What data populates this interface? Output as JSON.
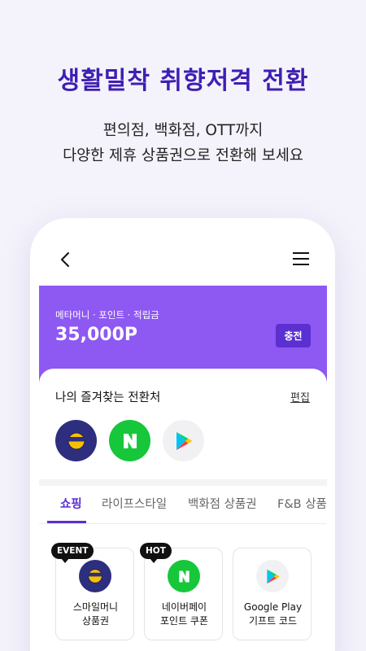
{
  "promo": {
    "headline": "생활밀착 취향저격 전환",
    "subtitle_line1": "편의점, 백화점, OTT까지",
    "subtitle_line2": "다양한 제휴 상품권으로 전환해 보세요"
  },
  "header": {
    "back_icon": "chevron-left-icon",
    "menu_icon": "hamburger-menu-icon"
  },
  "points": {
    "label": "메타머니 · 포인트 · 적립금",
    "value": "35,000P",
    "charge_label": "충전",
    "card_color": "#8e58f2"
  },
  "favorites": {
    "title": "나의 즐겨찾는 전환처",
    "edit_label": "편집",
    "items": [
      {
        "icon": "smile-money-icon",
        "color": "#2d2e7e"
      },
      {
        "icon": "naver-icon",
        "color": "#16c73a"
      },
      {
        "icon": "google-play-icon",
        "color": "#f1f1f3"
      }
    ]
  },
  "tabs": [
    {
      "label": "쇼핑",
      "active": true
    },
    {
      "label": "라이프스타일",
      "active": false
    },
    {
      "label": "백화점 상품권",
      "active": false
    },
    {
      "label": "F&B 상품권",
      "active": false
    }
  ],
  "products": [
    {
      "badge": "EVENT",
      "name": "스마일머니\n상품권",
      "icon": "smile-money-icon"
    },
    {
      "badge": "HOT",
      "name": "네이버페이\n포인트 쿠폰",
      "icon": "naver-icon"
    },
    {
      "badge": "",
      "name": "Google Play\n기프트 코드",
      "icon": "google-play-icon"
    }
  ],
  "accent_color": "#5b2fd0"
}
